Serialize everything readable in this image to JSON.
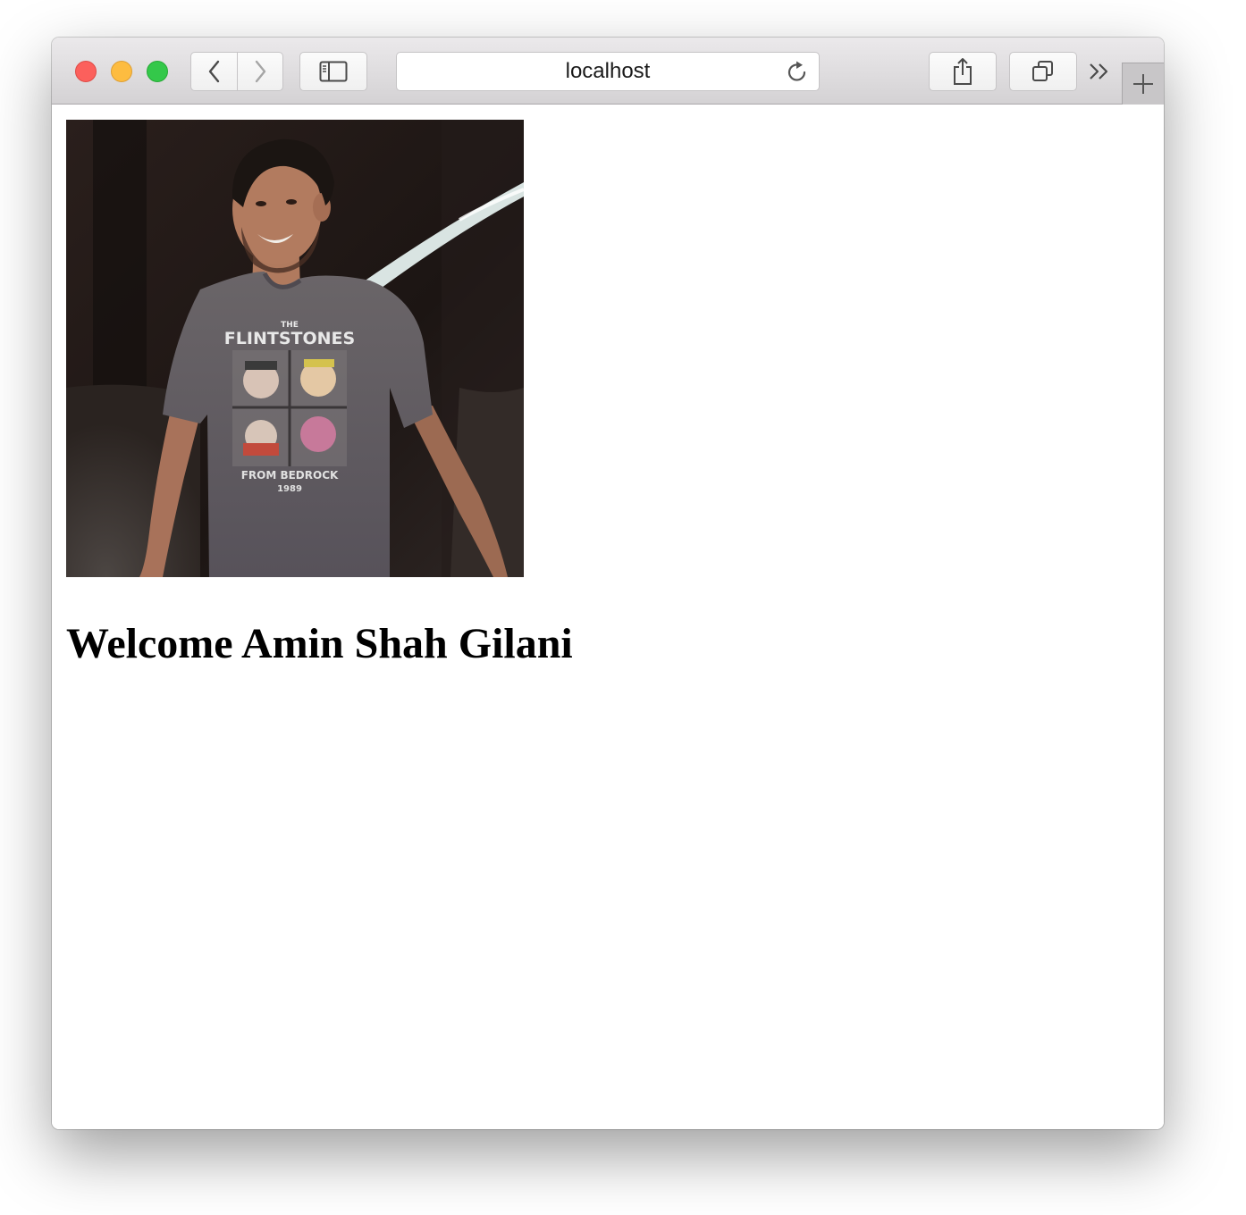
{
  "browser": {
    "address_bar": {
      "url": "localhost"
    },
    "icons": {
      "close": "close-traffic-light",
      "minimize": "minimize-traffic-light",
      "zoom": "zoom-traffic-light",
      "back": "chevron-left-icon",
      "forward": "chevron-right-icon",
      "sidebar": "sidebar-icon",
      "reload": "reload-icon",
      "share": "share-icon",
      "tabs": "tabs-overview-icon",
      "more": "double-chevron-icon",
      "new_tab": "plus-icon"
    },
    "colors": {
      "close": "#fc605c",
      "minimize": "#fdbc40",
      "zoom": "#34c84a"
    }
  },
  "page": {
    "heading": "Welcome Amin Shah Gilani",
    "photo": {
      "shirt_text_top": "THE",
      "shirt_text_main": "FLINTSTONES",
      "shirt_text_bottom": "FROM BEDROCK",
      "shirt_text_year": "1989"
    }
  }
}
